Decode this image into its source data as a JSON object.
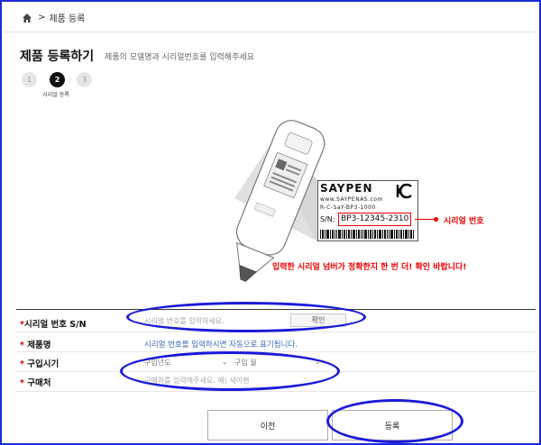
{
  "breadcrumb": {
    "separator": ">",
    "current": "제품 등록"
  },
  "page": {
    "title": "제품 등록하기",
    "subtitle": "제품의 모델명과 시리얼번호를 입력해주세요"
  },
  "steps": {
    "items": [
      "1",
      "2",
      "3"
    ],
    "active_index": 1,
    "active_caption": "시리얼 등록"
  },
  "illustration": {
    "brand": "SAYPEN",
    "url": "www.SAYPENAS.com",
    "model": "R-C-SaY-BP3-1000",
    "sn_prefix": "S/N:",
    "sn_value": "BP3-12345-2310",
    "callout": "시리얼 번호",
    "warning": "입력한 시리얼 넘버가 정확한지 한 번 더! 확인 바랍니다!"
  },
  "form": {
    "serial": {
      "label": "시리얼 번호 S/N",
      "required_mark": "*",
      "placeholder": "시리얼 번호를 입력하세요.",
      "confirm_label": "확인"
    },
    "product": {
      "label": "제품명",
      "required_mark": "*",
      "hint": "시리얼 번호를 입력하시면 자동으로 표기됩니다."
    },
    "purchase_date": {
      "label": "구입시기",
      "required_mark": "*",
      "year_selected": "구입년도",
      "month_selected": "구입 월"
    },
    "purchase_place": {
      "label": "구매처",
      "required_mark": "*",
      "placeholder": "구매처를 입력해주세요. 예) 세이펜"
    }
  },
  "buttons": {
    "prev": "이전",
    "submit": "등록"
  },
  "colors": {
    "annotation": "#1a1ad8",
    "accent_red": "#e00000",
    "hint_blue": "#3a6ab8"
  }
}
